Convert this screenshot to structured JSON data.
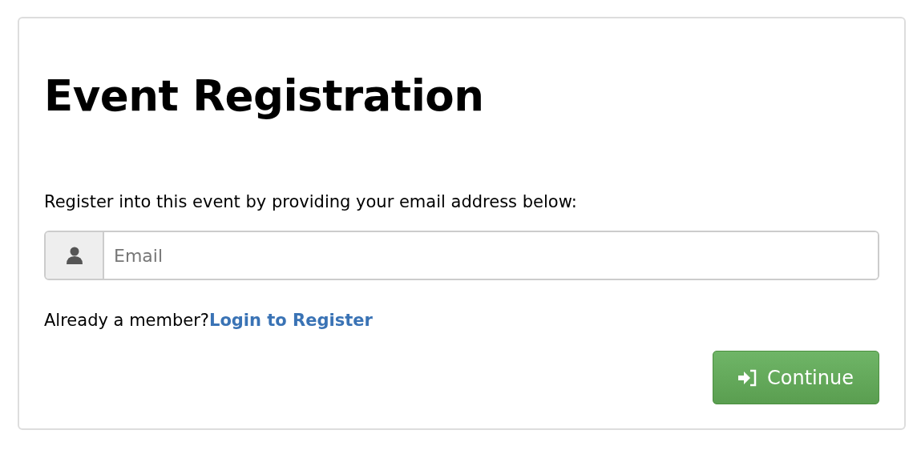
{
  "title": "Event Registration",
  "instructions": "Register into this event by providing your email address below:",
  "email_field": {
    "placeholder": "Email"
  },
  "member_prompt": "Already a member?",
  "login_link": "Login to Register",
  "continue_button": "Continue"
}
